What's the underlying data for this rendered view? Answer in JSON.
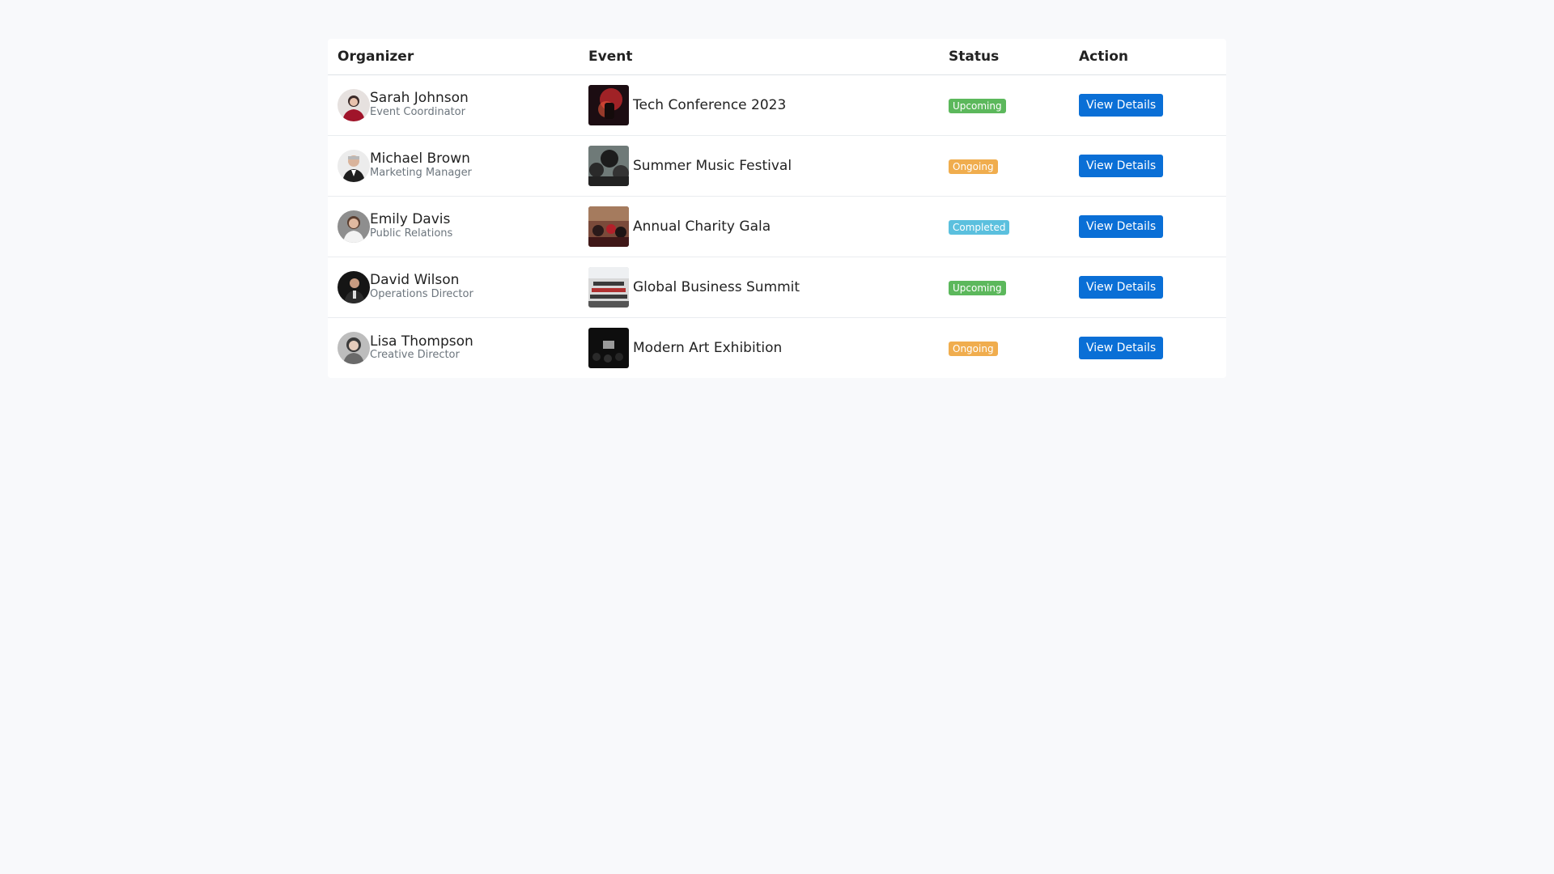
{
  "table": {
    "headers": {
      "organizer": "Organizer",
      "event": "Event",
      "status": "Status",
      "action": "Action"
    },
    "rows": [
      {
        "organizer_name": "Sarah Johnson",
        "organizer_role": "Event Coordinator",
        "event_title": "Tech Conference 2023",
        "status": "Upcoming",
        "status_color": "#5cb85c",
        "action_label": "View Details"
      },
      {
        "organizer_name": "Michael Brown",
        "organizer_role": "Marketing Manager",
        "event_title": "Summer Music Festival",
        "status": "Ongoing",
        "status_color": "#f0ad4e",
        "action_label": "View Details"
      },
      {
        "organizer_name": "Emily Davis",
        "organizer_role": "Public Relations",
        "event_title": "Annual Charity Gala",
        "status": "Completed",
        "status_color": "#5bc0de",
        "action_label": "View Details"
      },
      {
        "organizer_name": "David Wilson",
        "organizer_role": "Operations Director",
        "event_title": "Global Business Summit",
        "status": "Upcoming",
        "status_color": "#5cb85c",
        "action_label": "View Details"
      },
      {
        "organizer_name": "Lisa Thompson",
        "organizer_role": "Creative Director",
        "event_title": "Modern Art Exhibition",
        "status": "Ongoing",
        "status_color": "#f0ad4e",
        "action_label": "View Details"
      }
    ]
  },
  "colors": {
    "background": "#f8f9fb",
    "primary_button": "#0a6fd6"
  }
}
